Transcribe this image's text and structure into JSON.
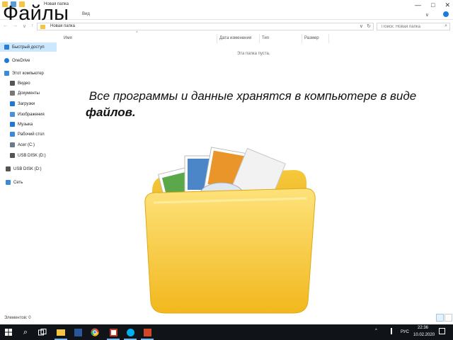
{
  "slide": {
    "title": "Файлы",
    "caption_prefix": "Все программы и данные хранятся в компьютере в виде ",
    "caption_bold": "файлов."
  },
  "window": {
    "title": "Новая папка",
    "controls": {
      "minimize": "—",
      "maximize": "□",
      "close": "✕"
    }
  },
  "ribbon": {
    "tab_view": "Вид",
    "chevron": "∨"
  },
  "address": {
    "path": "Новая папка",
    "search_placeholder": "Поиск: Новая папка"
  },
  "columns": [
    {
      "label": "Имя"
    },
    {
      "label": "Дата изменения"
    },
    {
      "label": "Тип"
    },
    {
      "label": "Размер"
    }
  ],
  "empty_message": "Эта папка пуста.",
  "sidebar": {
    "items": [
      {
        "label": "Быстрый доступ",
        "icon": "star-icon",
        "color": "#2b7cd3"
      },
      {
        "label": "OneDrive",
        "icon": "cloud-icon",
        "color": "#1e78d7"
      },
      {
        "label": "Этот компьютер",
        "icon": "computer-icon",
        "color": "#3a8ad9"
      },
      {
        "label": "Видео",
        "icon": "video-icon",
        "color": "#555555"
      },
      {
        "label": "Документы",
        "icon": "documents-icon",
        "color": "#777777"
      },
      {
        "label": "Загрузки",
        "icon": "download-icon",
        "color": "#1e78d7"
      },
      {
        "label": "Изображения",
        "icon": "pictures-icon",
        "color": "#4a8fd9"
      },
      {
        "label": "Музыка",
        "icon": "music-icon",
        "color": "#1e78d7"
      },
      {
        "label": "Рабочий стол",
        "icon": "desktop-icon",
        "color": "#3a8ad9"
      },
      {
        "label": "Acer (C:)",
        "icon": "drive-icon",
        "color": "#6b7a8a"
      },
      {
        "label": "USB DISK (D:)",
        "icon": "usb-icon",
        "color": "#555555"
      },
      {
        "label": "USB DISK (D:)",
        "icon": "usb-icon",
        "color": "#555555"
      },
      {
        "label": "Сеть",
        "icon": "network-icon",
        "color": "#3a8ad9"
      }
    ]
  },
  "status": {
    "items_text": "Элементов: 0"
  },
  "taskbar": {
    "start": "start-icon",
    "tray": {
      "chevron": "^",
      "lang": "РУС",
      "time": "22:36",
      "date": "10.02.2020"
    }
  },
  "colors": {
    "selection": "#cce8ff",
    "taskbar": "#101318",
    "folder": "#f7cf3b"
  }
}
